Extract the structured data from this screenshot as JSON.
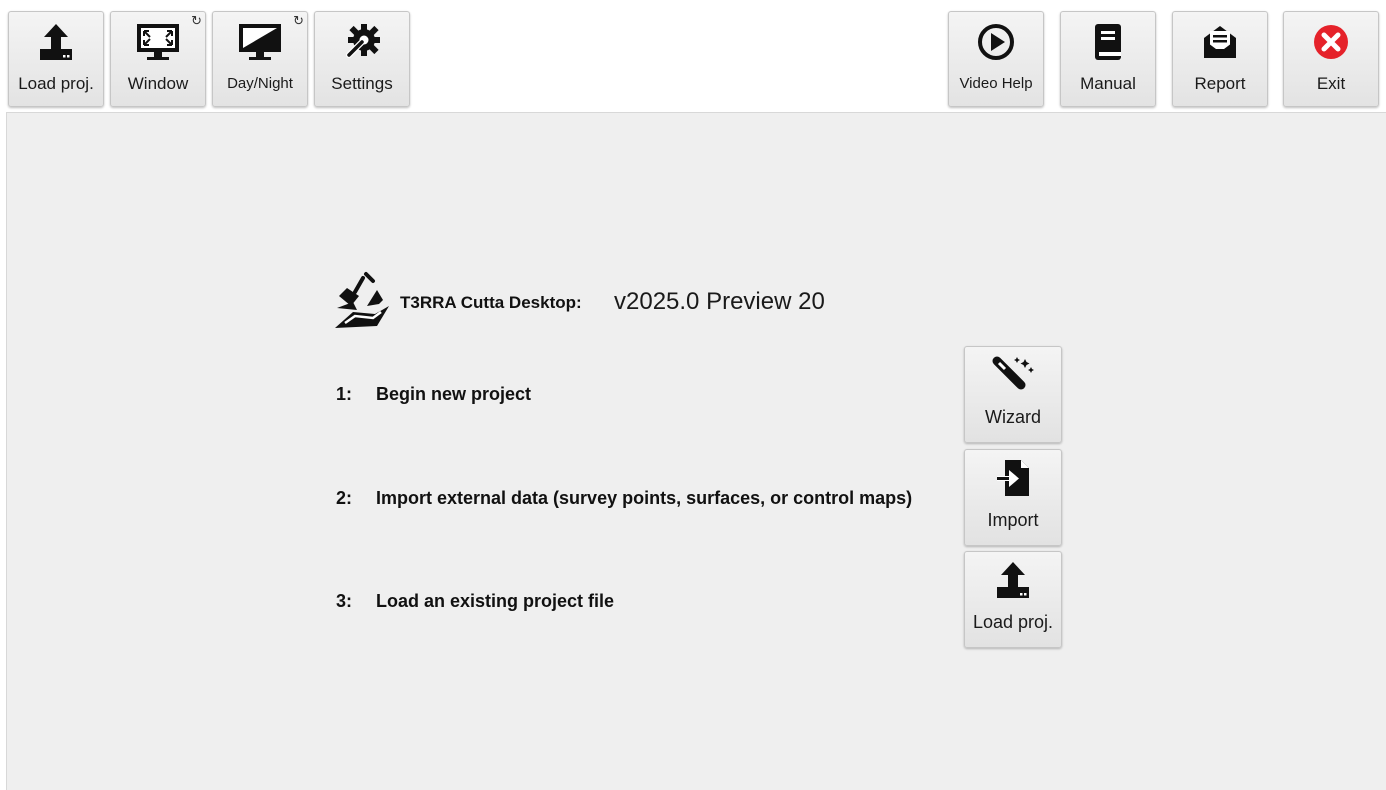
{
  "toolbar": {
    "left": [
      {
        "label": "Load proj.",
        "icon": "upload-icon"
      },
      {
        "label": "Window",
        "icon": "monitor-window-icon"
      },
      {
        "label": "Day/Night",
        "icon": "monitor-daynight-icon"
      },
      {
        "label": "Settings",
        "icon": "gear-wrench-icon"
      }
    ],
    "right": [
      {
        "label": "Video Help",
        "icon": "play-circle-icon"
      },
      {
        "label": "Manual",
        "icon": "book-icon"
      },
      {
        "label": "Report",
        "icon": "report-envelope-icon"
      },
      {
        "label": "Exit",
        "icon": "close-circle-icon"
      }
    ],
    "refresh_glyph": "↻"
  },
  "app": {
    "name": "T3RRA Cutta Desktop:",
    "version": "v2025.0 Preview 20",
    "logo_icon": "excavator-bucket-icon"
  },
  "steps": [
    {
      "num": "1:",
      "text": "Begin new project",
      "button": "Wizard",
      "icon": "magic-wand-icon"
    },
    {
      "num": "2:",
      "text": "Import external data (survey points, surfaces, or control maps)",
      "button": "Import",
      "icon": "file-import-icon"
    },
    {
      "num": "3:",
      "text": "Load an existing project file",
      "button": "Load proj.",
      "icon": "upload-icon"
    }
  ],
  "colors": {
    "exit_red": "#e5222a",
    "panel_bg": "#efefef",
    "button_bg": "#eaeaea"
  }
}
